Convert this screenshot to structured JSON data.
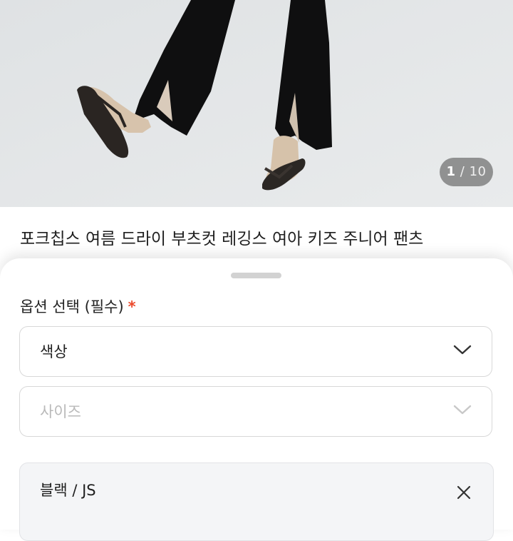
{
  "gallery": {
    "current": "1",
    "separator": "/",
    "total": "10"
  },
  "product": {
    "title": "포크칩스 여름 드라이 부츠컷 레깅스 여아 키즈 주니어 팬츠"
  },
  "option_sheet": {
    "section_label": "옵션 선택 (필수)",
    "required_mark": "*",
    "color_select": {
      "label": "색상",
      "icon": "chevron-down-icon"
    },
    "size_select": {
      "label": "사이즈",
      "icon": "chevron-down-icon",
      "disabled": true
    },
    "selected_item": {
      "label": "블랙 / JS",
      "icon": "close-icon"
    }
  },
  "colors": {
    "accent_required": "#ec4a2c",
    "photo_background": "#e4e6e8"
  }
}
